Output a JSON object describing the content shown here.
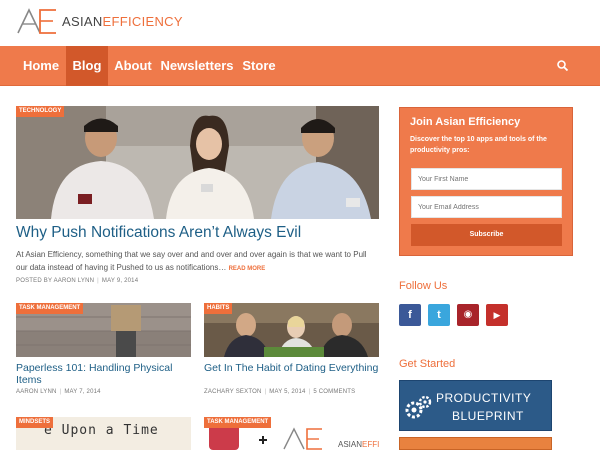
{
  "brand": {
    "name_a": "ASIAN",
    "name_b": "EFFICIENCY",
    "accent": "#ee6f3b"
  },
  "nav": {
    "items": [
      {
        "label": "Home"
      },
      {
        "label": "Blog"
      },
      {
        "label": "About"
      },
      {
        "label": "Newsletters"
      },
      {
        "label": "Store"
      }
    ],
    "active": "Blog"
  },
  "featured": {
    "tag": "TECHNOLOGY",
    "title": "Why Push Notifications Aren’t Always Evil",
    "excerpt": "At Asian Efficiency, something that we say over and and over and over again is that we want to Pull our data instead of having it Pushed to us as notifications…",
    "read_more": "READ MORE",
    "author": "POSTED BY AARON LYNN",
    "date": "MAY 9, 2014"
  },
  "posts": [
    {
      "tag": "TASK MANAGEMENT",
      "title": "Paperless 101: Handling Physical Items",
      "author": "AARON LYNN",
      "date": "MAY 7, 2014",
      "comments": ""
    },
    {
      "tag": "HABITS",
      "title": "Get In The Habit of Dating Everything",
      "author": "ZACHARY SEXTON",
      "date": "MAY 5, 2014",
      "comments": "5 COMMENTS"
    },
    {
      "tag": "MINDSETS",
      "title": "",
      "thumb_text": "e Upon a Time"
    },
    {
      "tag": "TASK MANAGEMENT",
      "title": "",
      "thumb_text_a": "ASIAN",
      "thumb_text_b": "EFFI"
    }
  ],
  "sidebar": {
    "join": {
      "title": "Join Asian Efficiency",
      "desc": "Discover the top 10 apps and tools of the productivity pros:",
      "first_name_placeholder": "Your First Name",
      "email_placeholder": "Your Email Address",
      "subscribe_label": "Subscribe"
    },
    "follow_title": "Follow Us",
    "social": [
      {
        "icon": "facebook-icon",
        "glyph": "f",
        "color": "#3b5998"
      },
      {
        "icon": "twitter-icon",
        "glyph": "t",
        "color": "#3aa6dd"
      },
      {
        "icon": "rss-icon",
        "glyph": "◉",
        "color": "#a8242a"
      },
      {
        "icon": "youtube-icon",
        "glyph": "▶",
        "color": "#c4302b"
      }
    ],
    "get_started_title": "Get Started",
    "blueprint": {
      "line1": "PRODUCTIVITY",
      "line2": "BLUEPRINT"
    }
  }
}
